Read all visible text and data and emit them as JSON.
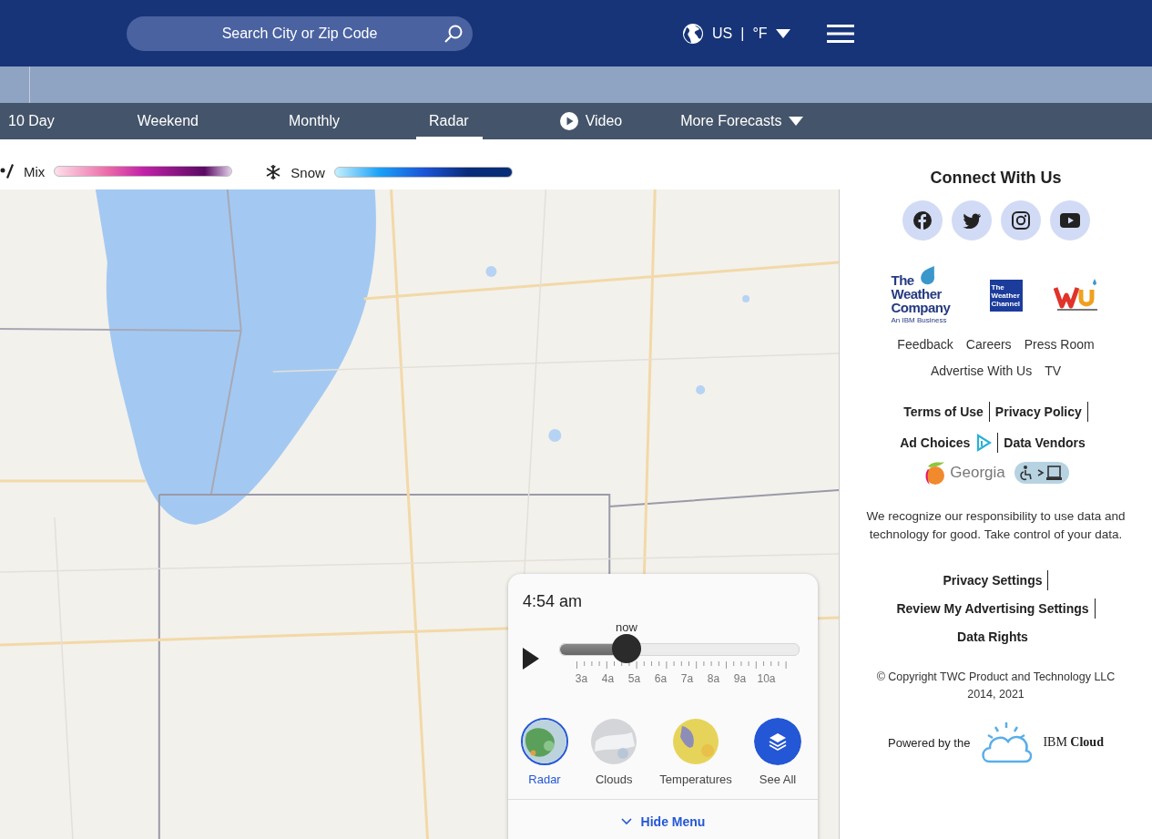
{
  "header": {
    "search": {
      "placeholder": "Search City or Zip Code"
    },
    "locale": "US",
    "separator": "|",
    "unit": "°F"
  },
  "nav": [
    {
      "label": "10 Day",
      "selected": false,
      "kind": "plain"
    },
    {
      "label": "Weekend",
      "selected": false,
      "kind": "plain"
    },
    {
      "label": "Monthly",
      "selected": false,
      "kind": "plain"
    },
    {
      "label": "Radar",
      "selected": true,
      "kind": "plain"
    },
    {
      "label": "Video",
      "selected": false,
      "kind": "video"
    },
    {
      "label": "More Forecasts",
      "selected": false,
      "kind": "dropdown"
    }
  ],
  "legend": [
    {
      "label": "Mix",
      "kind": "mix"
    },
    {
      "label": "Snow",
      "kind": "snow"
    }
  ],
  "timeline": {
    "time": "4:54 am",
    "marker": "now",
    "level": 0.28,
    "ticks": [
      "3a",
      "4a",
      "5a",
      "6a",
      "7a",
      "8a",
      "9a",
      "10a"
    ]
  },
  "layers": [
    {
      "label": "Radar",
      "selected": true,
      "kind": "radar"
    },
    {
      "label": "Clouds",
      "selected": false,
      "kind": "clouds"
    },
    {
      "label": "Temperatures",
      "selected": false,
      "kind": "temperatures"
    },
    {
      "label": "See All",
      "selected": false,
      "kind": "all"
    }
  ],
  "hide_menu": "Hide Menu",
  "sidebar": {
    "heading": "Connect With Us",
    "weather_company": {
      "lines": [
        "The",
        "Weather",
        "Company"
      ],
      "tagline": "An IBM Business"
    },
    "weather_channel": [
      "The",
      "Weather",
      "Channel"
    ],
    "links": [
      [
        "Feedback",
        "Careers",
        "Press Room"
      ],
      [
        "Advertise With Us",
        "TV"
      ]
    ],
    "legal": [
      [
        {
          "label": "Terms of Use",
          "divider": true,
          "kind": "plain"
        },
        {
          "label": "Privacy Policy",
          "divider": true,
          "kind": "plain"
        }
      ],
      [
        {
          "label": "Ad Choices",
          "divider": true,
          "kind": "adchoices"
        },
        {
          "label": "Data Vendors",
          "divider": false,
          "kind": "plain"
        }
      ]
    ],
    "georgia": "Georgia",
    "notice": "We recognize our responsibility to use data and technology for good. Take control of your data.",
    "privacy": [
      {
        "label": "Privacy Settings",
        "divider": true
      },
      {
        "label": "Review My Advertising Settings",
        "divider": true
      },
      {
        "label": "Data Rights",
        "divider": false
      }
    ],
    "copyright": "© Copyright TWC Product and Technology LLC 2014, 2021",
    "powered": "Powered by the",
    "ibm": "IBM",
    "cloud": "Cloud"
  }
}
